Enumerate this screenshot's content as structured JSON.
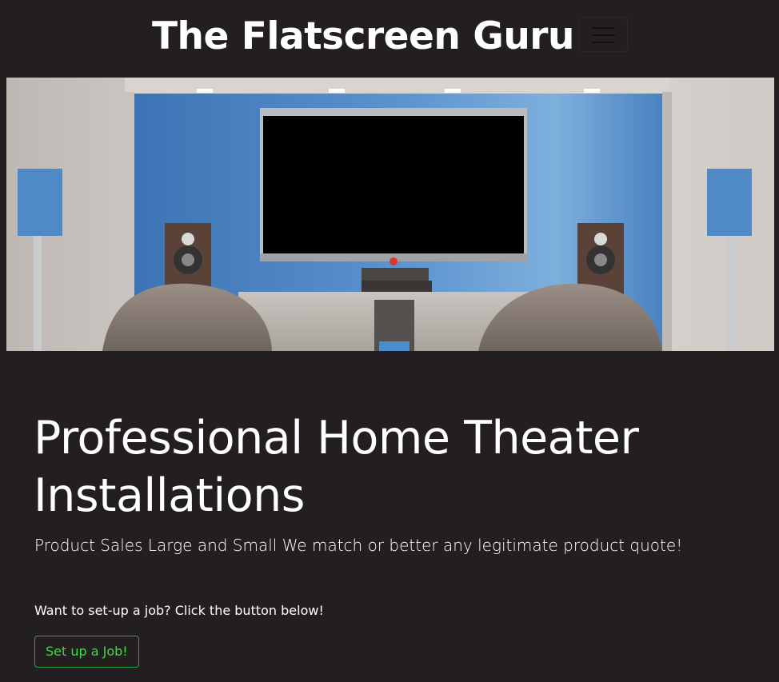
{
  "navbar": {
    "brand": "The Flatscreen Guru",
    "toggler_icon": "hamburger-menu-icon"
  },
  "hero": {
    "image_subject": "home-theater-room-image"
  },
  "main": {
    "headline": "Professional Home Theater Installations",
    "tagline": "Product Sales Large and Small We match or better any legitimate product quote!",
    "cta_text": "Want to set-up a job? Click the button below!",
    "cta_button": "Set up a Job!"
  },
  "colors": {
    "background": "#231f20",
    "text": "#ffffff",
    "button_border": "#28a745",
    "button_text": "#3ddc3d"
  }
}
